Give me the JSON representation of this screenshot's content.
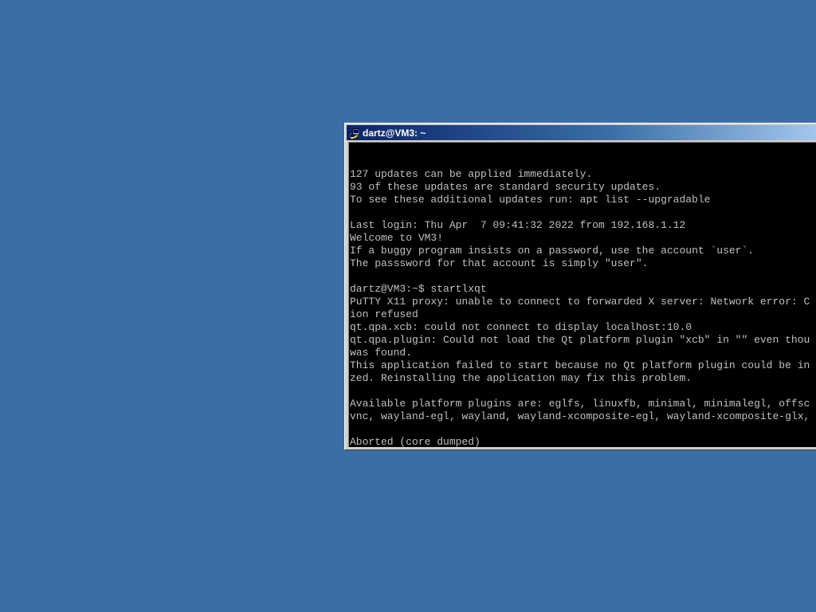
{
  "window": {
    "title": "dartz@VM3: ~",
    "icon": "putty-icon"
  },
  "terminal": {
    "lines": [
      "",
      "127 updates can be applied immediately.",
      "93 of these updates are standard security updates.",
      "To see these additional updates run: apt list --upgradable",
      "",
      "Last login: Thu Apr  7 09:41:32 2022 from 192.168.1.12",
      "Welcome to VM3!",
      "If a buggy program insists on a password, use the account `user`.",
      "The passsword for that account is simply \"user\".",
      "",
      "dartz@VM3:~$ startlxqt",
      "PuTTY X11 proxy: unable to connect to forwarded X server: Network error: C",
      "ion refused",
      "qt.qpa.xcb: could not connect to display localhost:10.0",
      "qt.qpa.plugin: Could not load the Qt platform plugin \"xcb\" in \"\" even thou",
      "was found.",
      "This application failed to start because no Qt platform plugin could be in",
      "zed. Reinstalling the application may fix this problem.",
      "",
      "Available platform plugins are: eglfs, linuxfb, minimal, minimalegl, offsc",
      "vnc, wayland-egl, wayland, wayland-xcomposite-egl, wayland-xcomposite-glx,",
      "",
      "Aborted (core dumped)"
    ],
    "prompt": "dartz@VM3:~$ ",
    "cursor_color": "#00ff00"
  },
  "colors": {
    "desktop": "#3a6ea5",
    "terminal_bg": "#000000",
    "terminal_fg": "#c0c0c0",
    "titlebar_start": "#0a246a"
  }
}
